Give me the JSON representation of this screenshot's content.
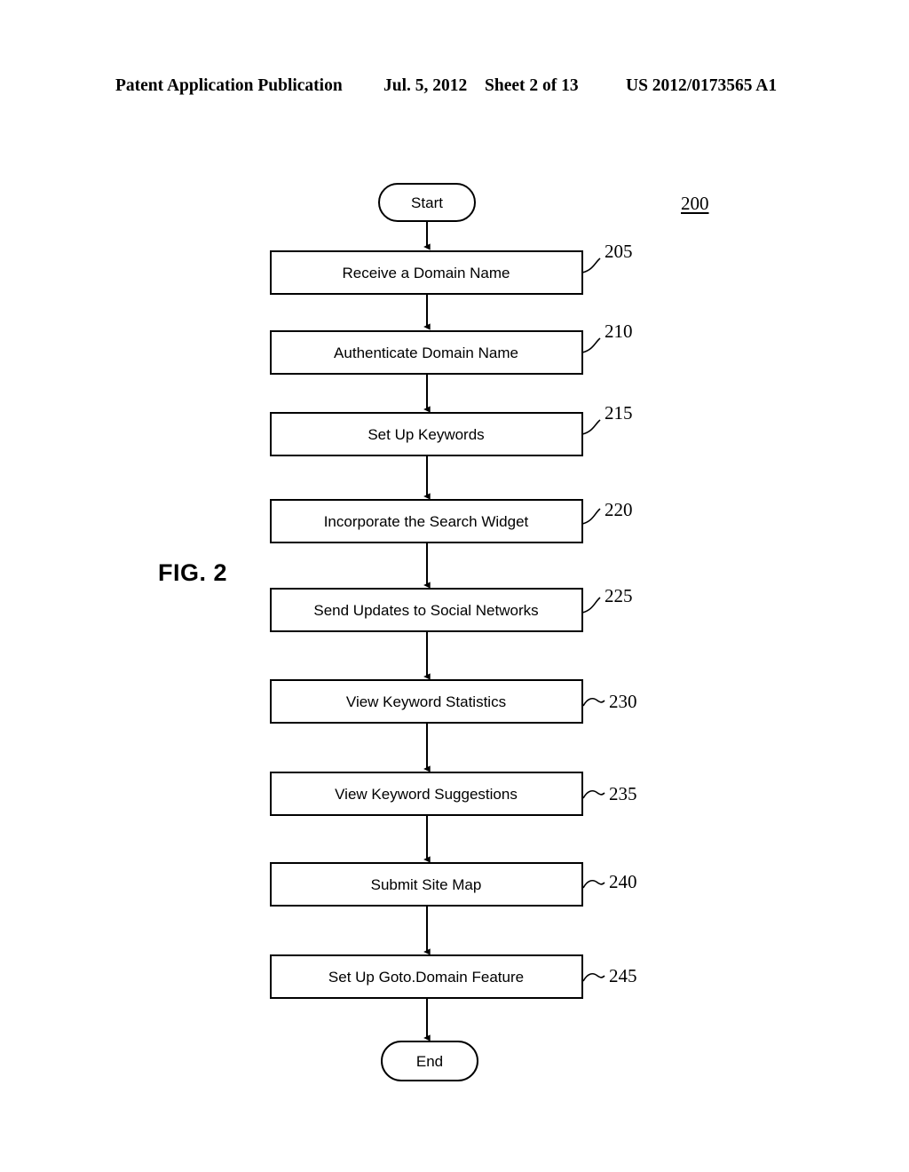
{
  "header": {
    "publication": "Patent Application Publication",
    "date": "Jul. 5, 2012",
    "sheet": "Sheet 2 of 13",
    "patent_number": "US 2012/0173565 A1"
  },
  "figure": {
    "label": "FIG. 2",
    "reference_numeral": "200"
  },
  "chart_data": {
    "type": "diagram",
    "title": "FIG. 2",
    "diagram_kind": "flowchart",
    "orientation": "vertical",
    "reference_numeral": "200",
    "nodes": [
      {
        "id": "start",
        "shape": "terminator",
        "label": "Start",
        "ref": ""
      },
      {
        "id": "n205",
        "shape": "process",
        "label": "Receive a Domain Name",
        "ref": "205",
        "leader": "diagonal"
      },
      {
        "id": "n210",
        "shape": "process",
        "label": "Authenticate Domain Name",
        "ref": "210",
        "leader": "diagonal"
      },
      {
        "id": "n215",
        "shape": "process",
        "label": "Set Up Keywords",
        "ref": "215",
        "leader": "diagonal"
      },
      {
        "id": "n220",
        "shape": "process",
        "label": "Incorporate the Search Widget",
        "ref": "220",
        "leader": "diagonal"
      },
      {
        "id": "n225",
        "shape": "process",
        "label": "Send Updates to Social Networks",
        "ref": "225",
        "leader": "diagonal"
      },
      {
        "id": "n230",
        "shape": "process",
        "label": "View Keyword Statistics",
        "ref": "230",
        "leader": "horizontal"
      },
      {
        "id": "n235",
        "shape": "process",
        "label": "View Keyword Suggestions",
        "ref": "235",
        "leader": "horizontal"
      },
      {
        "id": "n240",
        "shape": "process",
        "label": "Submit Site Map",
        "ref": "240",
        "leader": "horizontal"
      },
      {
        "id": "n245",
        "shape": "process",
        "label": "Set Up Goto.Domain Feature",
        "ref": "245",
        "leader": "horizontal"
      },
      {
        "id": "end",
        "shape": "terminator",
        "label": "End",
        "ref": ""
      }
    ],
    "edges": [
      {
        "from": "start",
        "to": "n205"
      },
      {
        "from": "n205",
        "to": "n210"
      },
      {
        "from": "n210",
        "to": "n215"
      },
      {
        "from": "n215",
        "to": "n220"
      },
      {
        "from": "n220",
        "to": "n225"
      },
      {
        "from": "n225",
        "to": "n230"
      },
      {
        "from": "n230",
        "to": "n235"
      },
      {
        "from": "n235",
        "to": "n240"
      },
      {
        "from": "n240",
        "to": "n245"
      },
      {
        "from": "n245",
        "to": "end"
      }
    ],
    "colors": {
      "stroke": "#000000",
      "fill": "#ffffff",
      "background": "#ffffff"
    }
  }
}
